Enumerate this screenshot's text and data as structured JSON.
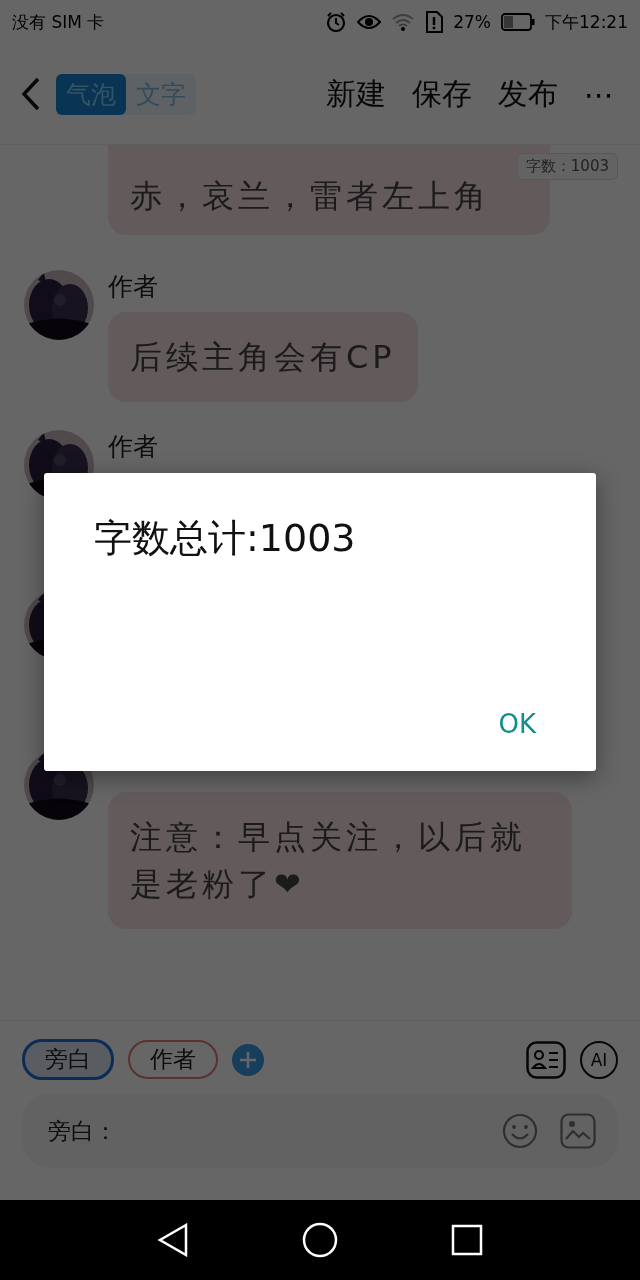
{
  "status_bar": {
    "carrier": "没有 SIM 卡",
    "battery": "27%",
    "time": "下午12:21"
  },
  "header": {
    "view_tabs": [
      {
        "label": "气泡",
        "selected": true
      },
      {
        "label": "文字",
        "selected": false
      }
    ],
    "actions": [
      "新建",
      "保存",
      "发布"
    ],
    "more": "⋯"
  },
  "word_count_badge": "字数：1003",
  "messages": [
    {
      "text": "赤，哀兰，雷者左上角",
      "avatar": false
    },
    {
      "name": "作者",
      "text": "后续主角会有CP",
      "avatar": true
    },
    {
      "name": "作者",
      "avatar": true
    },
    {
      "avatar": true
    },
    {
      "text": "注意：早点关注，以后就是老粉了❤",
      "avatar": true
    }
  ],
  "roles": [
    {
      "label": "旁白",
      "selected": true
    },
    {
      "label": "作者",
      "selected": false
    }
  ],
  "ai_button": "AI",
  "input": {
    "placeholder": "旁白："
  },
  "dialog": {
    "message": "字数总计:1003",
    "button": "OK"
  }
}
